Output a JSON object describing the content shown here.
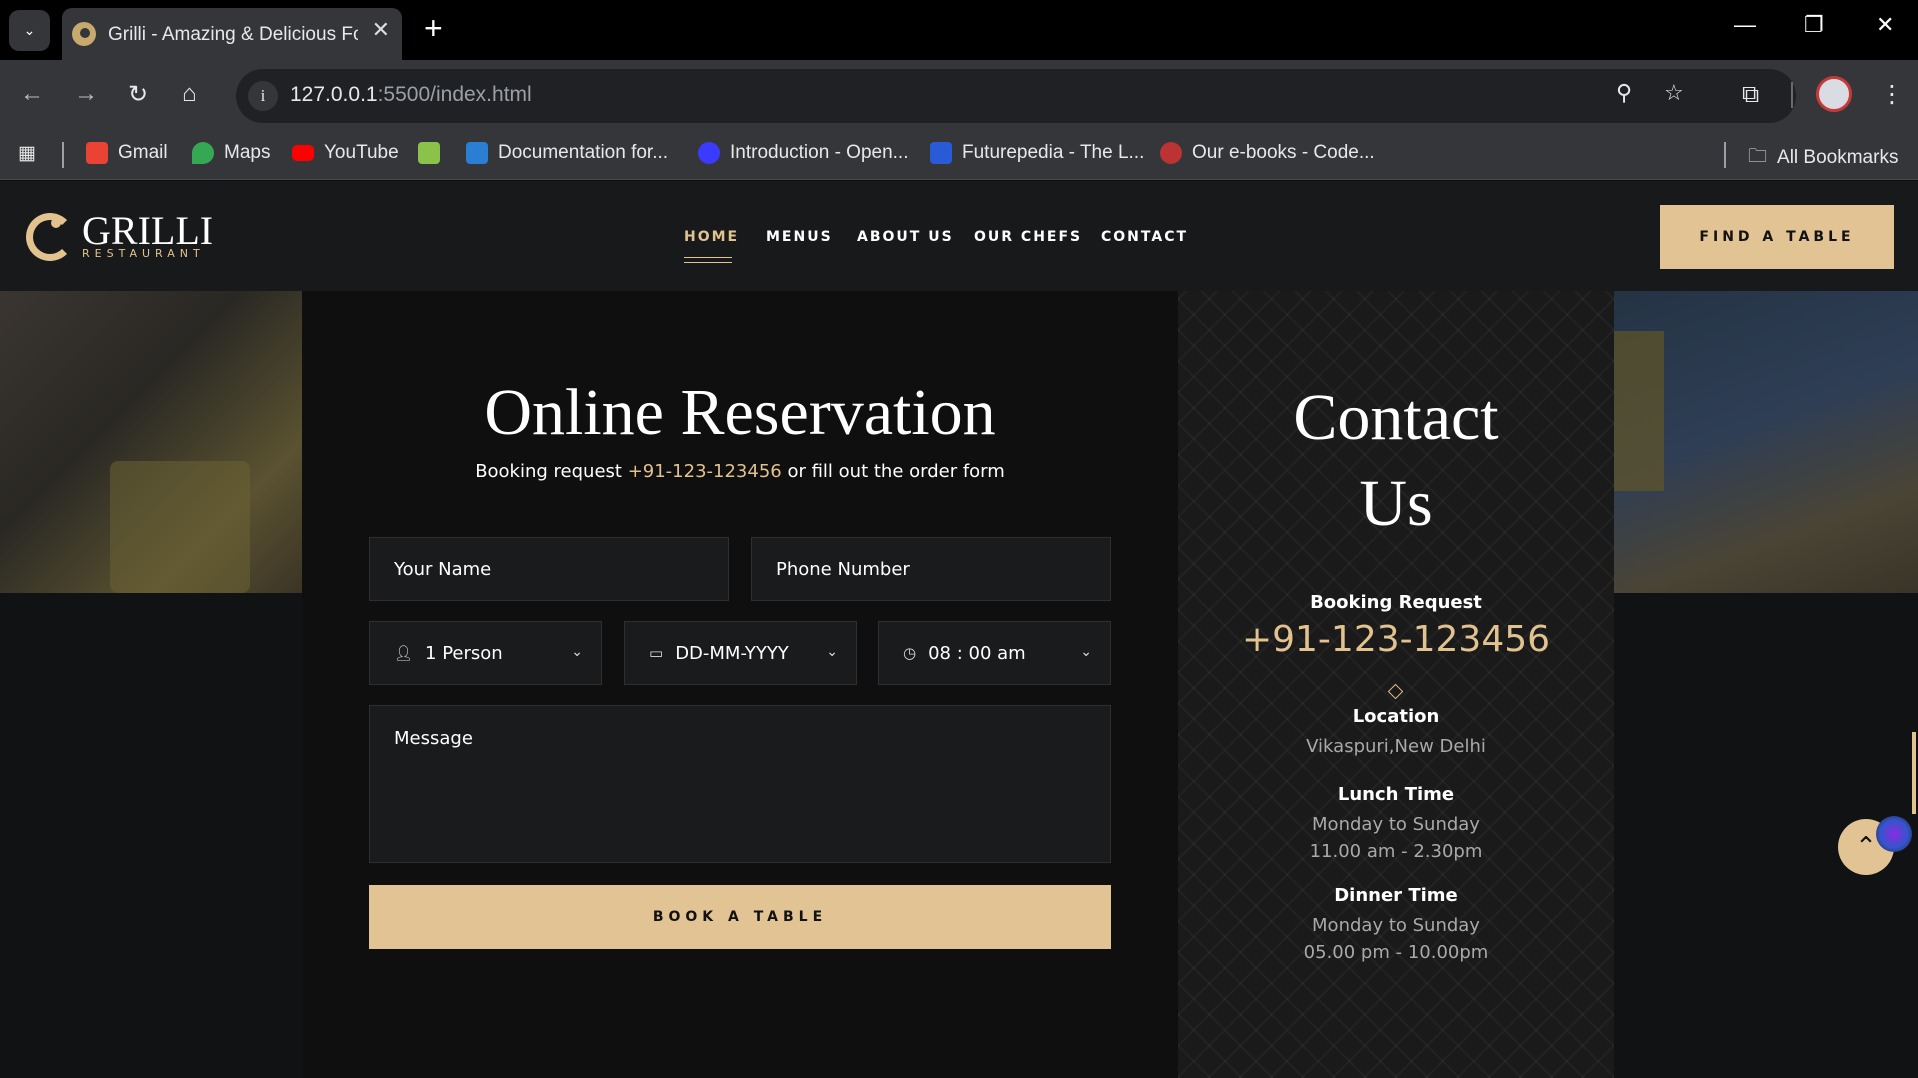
{
  "browser": {
    "tab_title": "Grilli - Amazing & Delicious Food",
    "url_host": "127.0.0.1",
    "url_rest": ":5500/index.html",
    "new_tab": "+",
    "bookmarks": [
      {
        "label": "Gmail",
        "color": "#ea4335"
      },
      {
        "label": "Maps",
        "color": "#34a853"
      },
      {
        "label": "YouTube",
        "color": "#ff0000"
      },
      {
        "label": "",
        "color": "#8bc34a"
      },
      {
        "label": "Documentation for...",
        "color": "#2a7fd4"
      },
      {
        "label": "Introduction - Open...",
        "color": "#3b3bff"
      },
      {
        "label": "Futurepedia - The L...",
        "color": "#2a5bd7"
      },
      {
        "label": "Our e-books - Code...",
        "color": "#b33"
      }
    ],
    "all_bookmarks": "All Bookmarks"
  },
  "site": {
    "logo_title": "GRILLI",
    "logo_sub": "RESTAURANT",
    "nav": [
      "HOME",
      "MENUS",
      "ABOUT US",
      "OUR CHEFS",
      "CONTACT"
    ],
    "find_table": "FIND A TABLE"
  },
  "reservation": {
    "title": "Online Reservation",
    "sub_before": "Booking request ",
    "sub_phone": "+91-123-123456",
    "sub_after": " or fill out the order form",
    "name_placeholder": "Your Name",
    "phone_placeholder": "Phone Number",
    "person": "1 Person",
    "date": "DD-MM-YYYY",
    "time": "08 : 00 am",
    "message_placeholder": "Message",
    "book_button": "BOOK A TABLE"
  },
  "contact": {
    "title_line1": "Contact",
    "title_line2": "Us",
    "booking_head": "Booking Request",
    "booking_phone": "+91-123-123456",
    "location_head": "Location",
    "location": "Vikaspuri,New Delhi",
    "lunch_head": "Lunch Time",
    "lunch_days": "Monday to Sunday",
    "lunch_hours": "11.00 am - 2.30pm",
    "dinner_head": "Dinner Time",
    "dinner_days": "Monday to Sunday",
    "dinner_hours": "05.00 pm - 10.00pm"
  },
  "colors": {
    "accent": "#e2c393",
    "bg": "#111214"
  }
}
